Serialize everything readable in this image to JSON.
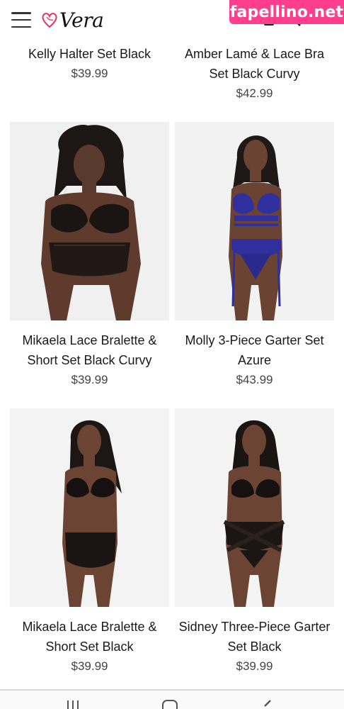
{
  "brand": {
    "logo_text": "Vera"
  },
  "watermark": {
    "text": "fapellino.net"
  },
  "products": [
    {
      "name": "Kelly Halter Set Black",
      "price": "$39.99"
    },
    {
      "name": "Amber Lamé & Lace Bra Set Black Curvy",
      "price": "$42.99"
    },
    {
      "name": "Mikaela Lace Bralette & Short Set Black Curvy",
      "price": "$39.99"
    },
    {
      "name": "Molly 3-Piece Garter Set Azure",
      "price": "$43.99"
    },
    {
      "name": "Mikaela Lace Bralette & Short Set Black",
      "price": "$39.99"
    },
    {
      "name": "Sidney Three-Piece Garter Set Black",
      "price": "$39.99"
    }
  ],
  "icons": {
    "menu": "hamburger-icon",
    "logo": "heart-logo-icon",
    "account": "account-icon",
    "search": "search-icon",
    "cart": "cart-icon",
    "nav_recent": "recent-apps-icon",
    "nav_home": "home-icon",
    "nav_back": "back-icon"
  },
  "colors": {
    "watermark": "#ff3f8e",
    "logo_heart": "#e0356b",
    "bra_azure": "#2f2f9e"
  }
}
